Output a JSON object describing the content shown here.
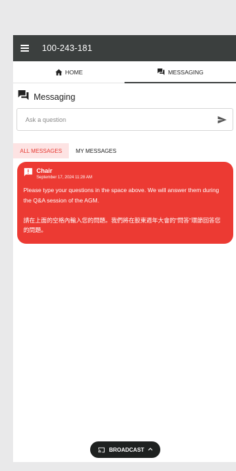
{
  "header": {
    "title": "100-243-181",
    "menu_icon": "hamburger-menu-icon"
  },
  "tabs": [
    {
      "label": "HOME",
      "icon": "home-icon",
      "active": false
    },
    {
      "label": "MESSAGING",
      "icon": "forum-icon",
      "active": true
    }
  ],
  "section": {
    "title": "Messaging",
    "icon": "forum-icon"
  },
  "ask": {
    "placeholder": "Ask a question",
    "value": "",
    "send_icon": "send-icon"
  },
  "subtabs": [
    {
      "label": "ALL MESSAGES",
      "active": true
    },
    {
      "label": "MY MESSAGES",
      "active": false
    }
  ],
  "messages": [
    {
      "author": "Chair",
      "time": "September 17, 2024 11:28 AM",
      "text": "Please type your questions in the space above.  We will answer them during the Q&A session of the AGM.\n\n請在上面的空格內輸入您的問題。我們將在股東週年大會的\"問答\"環節回答您的問題。",
      "icon": "alert-message-icon",
      "color": "#ec3a33"
    }
  ],
  "broadcast": {
    "label": "BROADCAST",
    "icon": "cast-icon",
    "chevron": "chevron-up-icon"
  }
}
